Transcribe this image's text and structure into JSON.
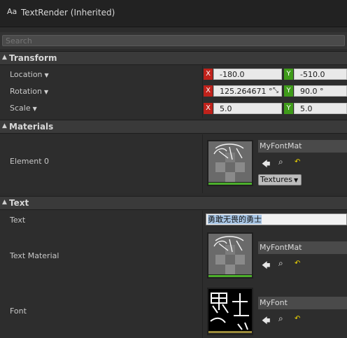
{
  "window": {
    "icon_glyph": "Aa",
    "title": "TextRender (Inherited)"
  },
  "search": {
    "placeholder": "Search"
  },
  "transform": {
    "header": "Transform",
    "location": {
      "label": "Location",
      "x": "-180.0",
      "y": "-510.0"
    },
    "rotation": {
      "label": "Rotation",
      "x": "125.264671 °",
      "y": "90.0 °"
    },
    "scale": {
      "label": "Scale",
      "x": "5.0",
      "y": "5.0"
    },
    "axis_x": "X",
    "axis_y": "Y"
  },
  "materials": {
    "header": "Materials",
    "element0": {
      "label": "Element 0",
      "asset": "MyFontMat",
      "textures_button": "Textures"
    }
  },
  "text": {
    "header": "Text",
    "text_label": "Text",
    "text_value": "勇敢无畏的勇士",
    "material_label": "Text Material",
    "material_asset": "MyFontMat",
    "font_label": "Font",
    "font_asset": "MyFont"
  },
  "colors": {
    "accent_green": "#4caf2b",
    "font_bar": "#9b8a3a",
    "axis_x": "#c0221b",
    "axis_y": "#3f9b1a"
  },
  "icons": [
    "expand-arrow-icon",
    "dropdown-arrow-icon",
    "browse-arrow-icon",
    "search-icon",
    "reset-icon",
    "lock-icon"
  ]
}
